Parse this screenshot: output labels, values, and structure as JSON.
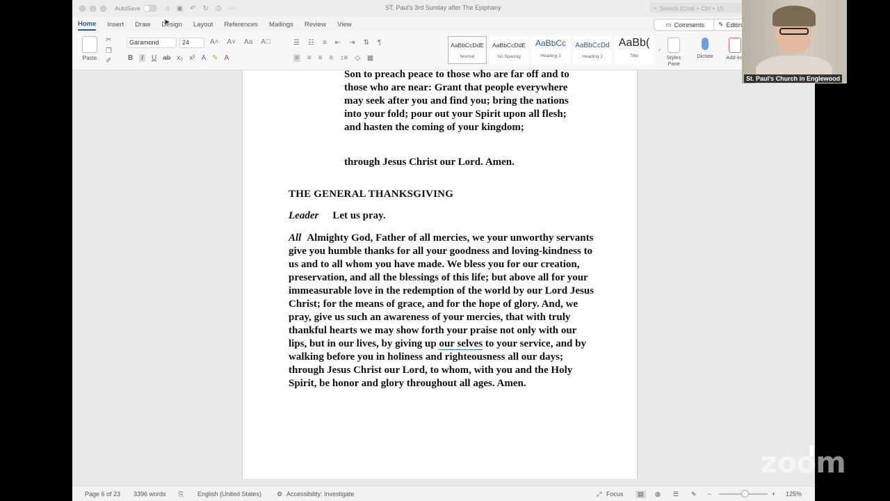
{
  "window": {
    "autosave_label": "AutoSave",
    "doc_title": "ST. Paul's 3rd Sunday after The Epiphany",
    "search_placeholder": "Search (Cmd + Ctrl + U)"
  },
  "tabs": [
    "Home",
    "Insert",
    "Draw",
    "Design",
    "Layout",
    "References",
    "Mailings",
    "Review",
    "View"
  ],
  "ribbon": {
    "comments_label": "Comments",
    "editing_label": "Editing",
    "paste_label": "Paste",
    "font_name": "Garamond",
    "font_size": "24",
    "styles": [
      {
        "preview": "AaBbCcDdE",
        "name": "Normal"
      },
      {
        "preview": "AaBbCcDdE",
        "name": "No Spacing"
      },
      {
        "preview": "AaBbCc",
        "name": "Heading 1"
      },
      {
        "preview": "AaBbCcDd",
        "name": "Heading 2"
      },
      {
        "preview": "AaBb(",
        "name": "Title"
      }
    ],
    "styles_pane_label": "Styles Pane",
    "dictate_label": "Dictate",
    "addins_label": "Add-ins"
  },
  "document": {
    "collect_text": "Son to preach peace to those who are far off and to those who are near: Grant that people everywhere may seek after you and find you; bring the nations into your fold; pour out your Spirit upon all flesh; and hasten the coming of your kingdom;",
    "collect_amen": "through Jesus Christ our Lord. Amen.",
    "heading": "THE GENERAL THANKSGIVING",
    "leader_label": "Leader",
    "leader_text": "Let us pray.",
    "all_label": "All",
    "all_text_before": "Almighty God, Father of all mercies, we your unworthy servants give you humble thanks for all your goodness and loving-kindness to us and to all whom you have made. We bless you for our creation, preservation, and all the blessings of this life; but above all for your immeasurable love in the redemption of the world by our Lord Jesus Christ; for the means of grace, and for the hope of glory. And, we pray, give us such an awareness of your mercies, that with truly thankful hearts we may show forth your praise not only with our lips, but in our lives, by giving up",
    "all_text_flagged": "our selves",
    "all_text_after": "to your service, and by walking before you in holiness and righteousness all our days; through Jesus Christ our Lord, to whom, with you and the Holy Spirit, be honor and glory throughout all ages. Amen."
  },
  "status": {
    "page": "Page 6 of 23",
    "words": "3396 words",
    "language": "English (United States)",
    "accessibility": "Accessibility: Investigate",
    "focus": "Focus",
    "zoom": "125%"
  },
  "video": {
    "participant_name": "St. Paul's Church in Englewood",
    "watermark": "zoom"
  }
}
